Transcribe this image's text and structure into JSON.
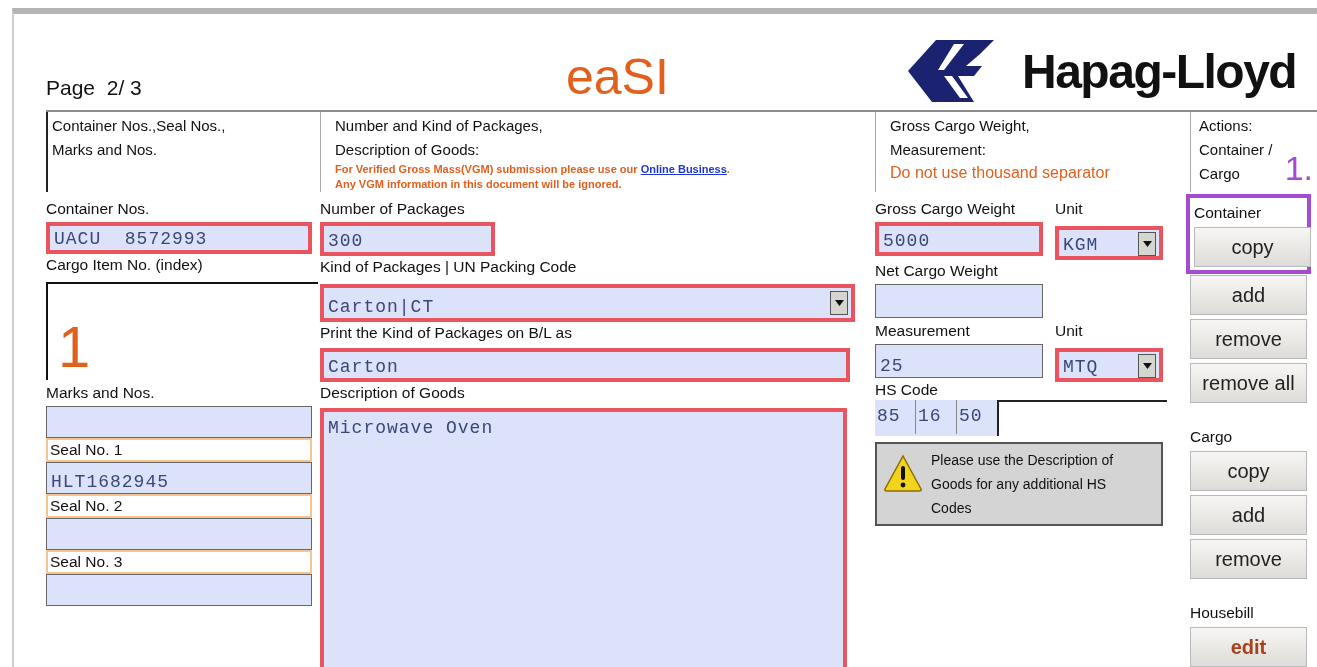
{
  "page_indicator": "Page  2/ 3",
  "form_title": "eaSI",
  "logo": {
    "text": "Hapag-Lloyd"
  },
  "headings": [
    {
      "lines": [
        "Container Nos.,Seal Nos.,",
        "Marks and Nos."
      ]
    },
    {
      "lines": [
        "Number and Kind of Packages,",
        "Description of Goods:"
      ],
      "note": {
        "before": "For Verified Gross Mass(VGM) submission please use our ",
        "link": "Online Business",
        "after": ".",
        "second_line": "Any VGM information in this document will be ignored."
      }
    },
    {
      "lines": [
        "Gross Cargo Weight,",
        "Measurement:"
      ],
      "warning": "Do not use thousand separator"
    },
    {
      "lines": [
        "Actions:",
        "Container /",
        "Cargo"
      ],
      "annotation": "1."
    }
  ],
  "container_column": {
    "container_nos": {
      "label": "Container Nos.",
      "kind": "text",
      "value": "UACU  8572993",
      "required": true
    },
    "cargo_item": {
      "label": "Cargo Item No. (index)",
      "index": "1"
    },
    "marks": {
      "label": "Marks and Nos.",
      "kind": "text",
      "required": false
    },
    "seals": [
      {
        "label": "Seal No. 1",
        "value": "HLT1682945"
      },
      {
        "label": "Seal No. 2"
      },
      {
        "label": "Seal No. 3"
      }
    ]
  },
  "goods_column": {
    "fields": [
      {
        "label": "Number of Packages",
        "kind": "short",
        "value": "300",
        "required": true
      },
      {
        "label": "Kind of Packages | UN Packing Code",
        "kind": "select",
        "value": "Carton|CT",
        "required": true
      },
      {
        "label": "Print the Kind of Packages on B/L as",
        "kind": "text",
        "value": "Carton",
        "required": true
      },
      {
        "label": "Description of Goods",
        "kind": "textarea",
        "value": "Microwave Oven",
        "required": true
      }
    ]
  },
  "weight_column": {
    "rows": [
      {
        "field": {
          "label": "Gross Cargo Weight",
          "kind": "text",
          "value": "5000",
          "required": true
        },
        "unit": {
          "label": "Unit",
          "kind": "select",
          "value": "KGM",
          "required": true
        }
      },
      {
        "field": {
          "label": "Net Cargo Weight",
          "kind": "text",
          "required": false
        }
      },
      {
        "field": {
          "label": "Measurement",
          "kind": "text",
          "value": "25",
          "required": false
        },
        "unit": {
          "label": "Unit",
          "kind": "select",
          "value": "MTQ",
          "required": true
        }
      }
    ],
    "hs_code": {
      "label": "HS Code",
      "segments": [
        "85",
        "16",
        "50"
      ]
    },
    "notice": "Please use the Description of Goods for any additional HS Codes"
  },
  "actions": [
    {
      "label": "Container",
      "highlighted": true,
      "buttons": [
        {
          "label": "copy",
          "accent": false
        },
        {
          "label": "add",
          "accent": false
        },
        {
          "label": "remove",
          "accent": false
        },
        {
          "label": "remove all",
          "accent": false
        }
      ]
    },
    {
      "label": "Cargo",
      "highlighted": false,
      "buttons": [
        {
          "label": "copy",
          "accent": false
        },
        {
          "label": "add",
          "accent": false
        },
        {
          "label": "remove",
          "accent": false
        }
      ]
    },
    {
      "label": "Housebill",
      "highlighted": false,
      "buttons": [
        {
          "label": "edit",
          "accent": true
        }
      ]
    }
  ]
}
